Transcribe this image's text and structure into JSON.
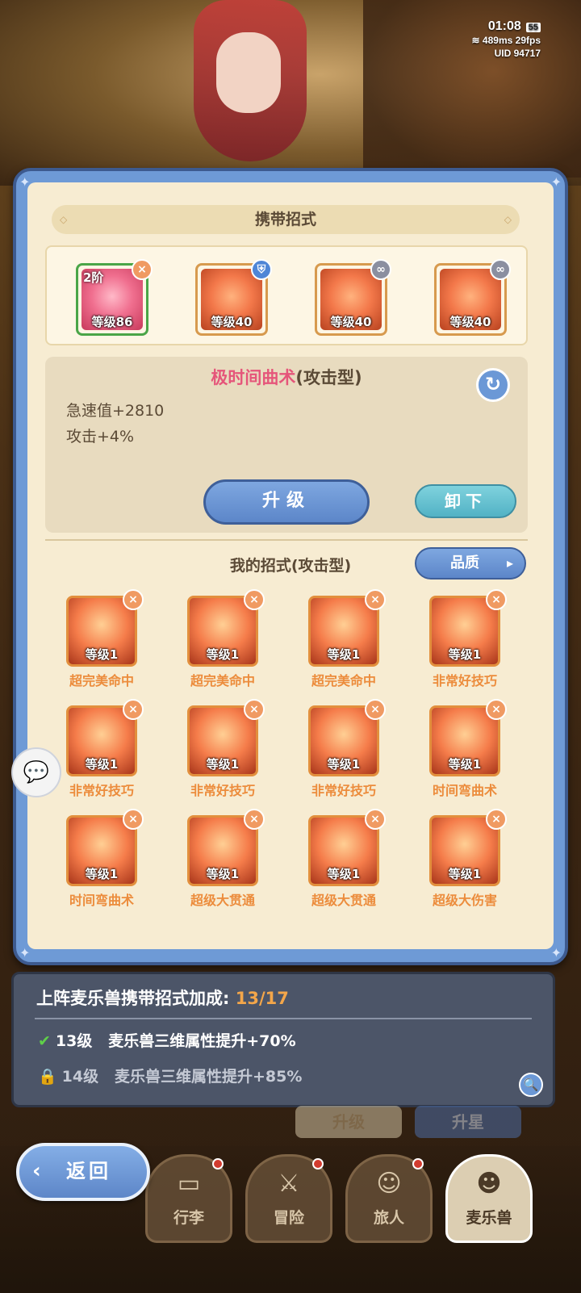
{
  "status": {
    "time": "01:08",
    "battery": "55",
    "ping": "489ms",
    "fps": "29fps",
    "uid_label": "UID",
    "uid": "94717"
  },
  "panel": {
    "title": "携带招式",
    "equipped": [
      {
        "tier": "2阶",
        "level": "等级86",
        "badge": "×",
        "badge_type": "remove",
        "selected": true
      },
      {
        "tier": "",
        "level": "等级40",
        "badge": "⛨",
        "badge_type": "shield",
        "selected": false
      },
      {
        "tier": "",
        "level": "等级40",
        "badge": "∞",
        "badge_type": "link",
        "selected": false
      },
      {
        "tier": "",
        "level": "等级40",
        "badge": "∞",
        "badge_type": "link",
        "selected": false
      }
    ],
    "detail": {
      "name": "极时间曲术",
      "type": "(攻击型)",
      "stats": [
        "急速值+2810",
        "攻击+4%"
      ],
      "upgrade_label": "升级",
      "unequip_label": "卸下"
    },
    "my_moves_title": "我的招式(攻击型)",
    "quality_label": "品质",
    "moves": [
      {
        "level": "等级1",
        "name": "超完美命中"
      },
      {
        "level": "等级1",
        "name": "超完美命中"
      },
      {
        "level": "等级1",
        "name": "超完美命中"
      },
      {
        "level": "等级1",
        "name": "非常好技巧"
      },
      {
        "level": "等级1",
        "name": "非常好技巧"
      },
      {
        "level": "等级1",
        "name": "非常好技巧"
      },
      {
        "level": "等级1",
        "name": "非常好技巧"
      },
      {
        "level": "等级1",
        "name": "时间弯曲术"
      },
      {
        "level": "等级1",
        "name": "时间弯曲术"
      },
      {
        "level": "等级1",
        "name": "超级大贯通"
      },
      {
        "level": "等级1",
        "name": "超级大贯通"
      },
      {
        "level": "等级1",
        "name": "超级大伤害"
      }
    ]
  },
  "bonus": {
    "title": "上阵麦乐兽携带招式加成:",
    "count": "13/17",
    "rows": [
      {
        "level": "13级",
        "text": "麦乐兽三维属性提升+70%",
        "unlocked": true
      },
      {
        "level": "14级",
        "text": "麦乐兽三维属性提升+85%",
        "unlocked": false
      }
    ]
  },
  "behind": {
    "left": "升级",
    "right": "升星"
  },
  "nav": {
    "back_label": "返回",
    "tabs": [
      {
        "label": "行李",
        "icon": "▭",
        "dot": true,
        "active": false
      },
      {
        "label": "冒险",
        "icon": "⚔",
        "dot": true,
        "active": false
      },
      {
        "label": "旅人",
        "icon": "☺",
        "dot": true,
        "active": false
      },
      {
        "label": "麦乐兽",
        "icon": "☻",
        "dot": false,
        "active": true
      }
    ]
  }
}
